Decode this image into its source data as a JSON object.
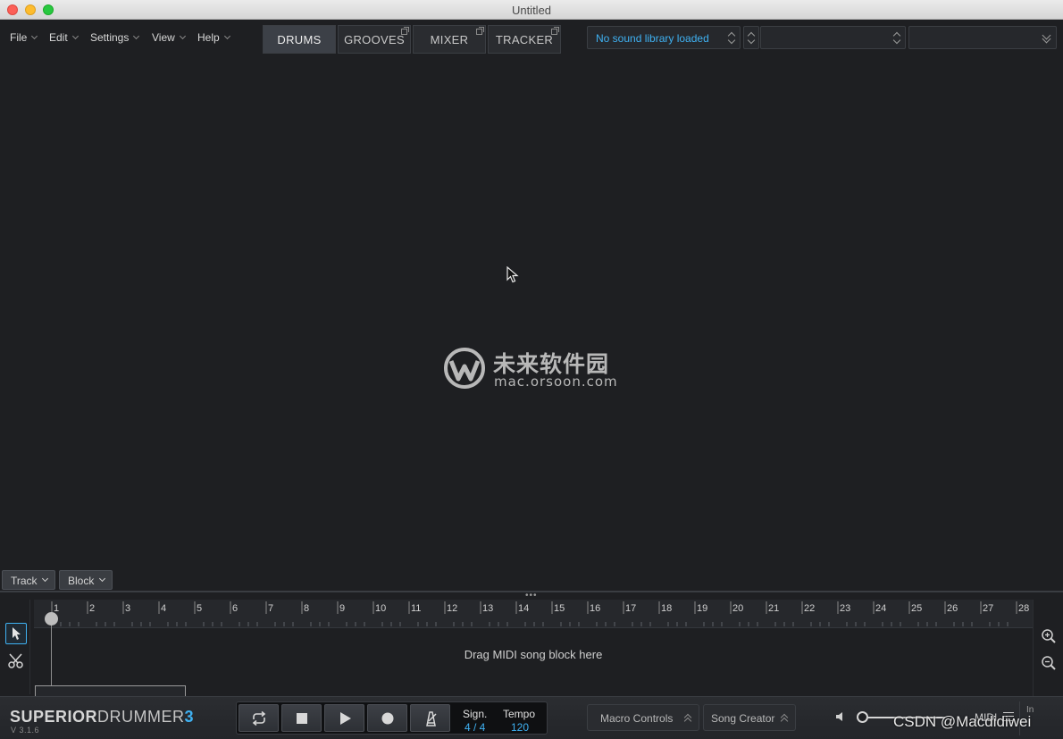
{
  "window": {
    "title": "Untitled"
  },
  "menus": [
    {
      "label": "File"
    },
    {
      "label": "Edit"
    },
    {
      "label": "Settings"
    },
    {
      "label": "View"
    },
    {
      "label": "Help"
    }
  ],
  "tabs": [
    {
      "label": "DRUMS",
      "active": true
    },
    {
      "label": "GROOVES",
      "active": false
    },
    {
      "label": "MIXER",
      "active": false
    },
    {
      "label": "TRACKER",
      "active": false
    }
  ],
  "library": {
    "selected": "No sound library loaded",
    "preset": "",
    "second": ""
  },
  "watermark": {
    "chinese": "未来软件园",
    "url": "mac.orsoon.com"
  },
  "song": {
    "track_label": "Track",
    "block_label": "Block",
    "drop_hint": "Drag MIDI song block here",
    "bars": [
      "1",
      "2",
      "3",
      "4",
      "5",
      "6",
      "7",
      "8",
      "9",
      "10",
      "11",
      "12",
      "13",
      "14",
      "15",
      "16",
      "17",
      "18",
      "19",
      "20",
      "21",
      "22",
      "23",
      "24",
      "25",
      "26",
      "27",
      "28"
    ]
  },
  "brand": {
    "part1": "SUPERIOR",
    "part2": "DRUMMER",
    "part3": "3",
    "version": "V 3.1.6"
  },
  "transport": {
    "sign_label": "Sign.",
    "sign_value": "4 / 4",
    "tempo_label": "Tempo",
    "tempo_value": "120"
  },
  "macro_label": "Macro Controls",
  "song_creator_label": "Song Creator",
  "midi_label": "MIDI",
  "in_label": "In",
  "overlay_text": "CSDN @Macdidiwei",
  "colors": {
    "accent": "#3fb1f2",
    "background": "#1e1f22"
  }
}
